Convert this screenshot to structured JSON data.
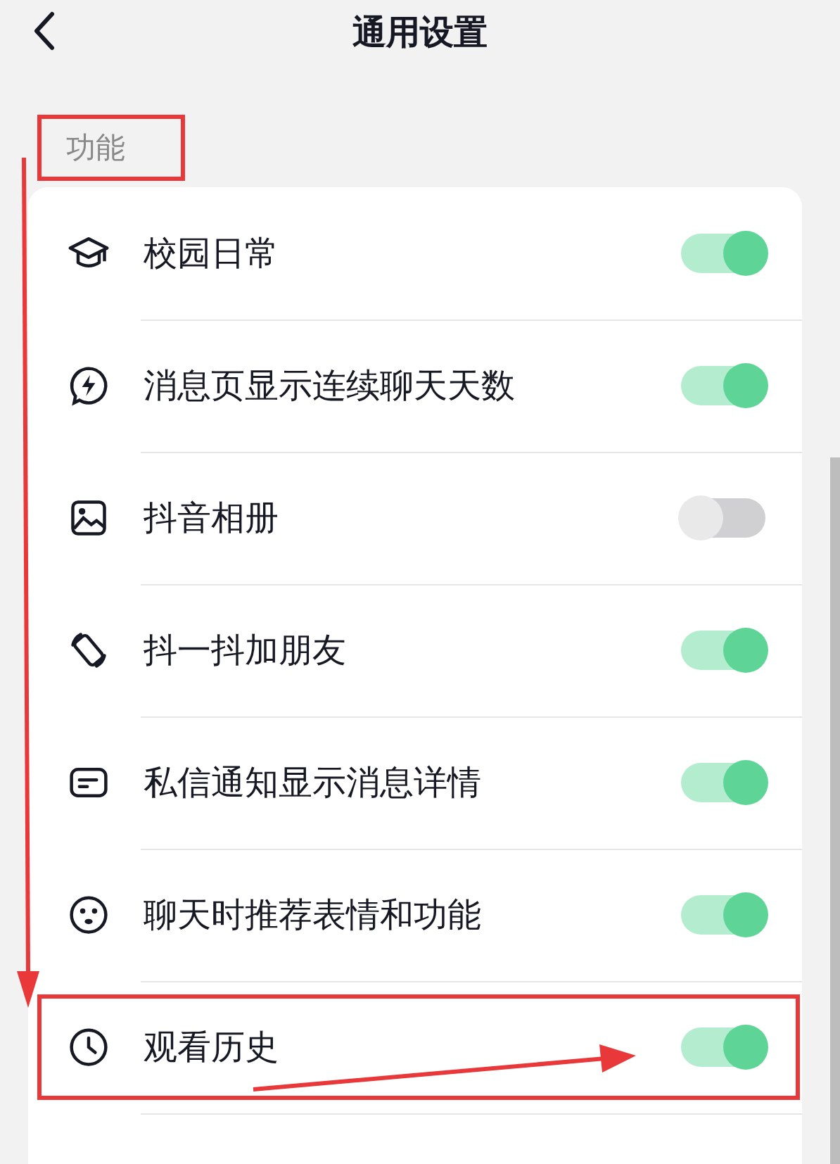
{
  "header": {
    "title": "通用设置"
  },
  "section": {
    "title": "功能"
  },
  "items": [
    {
      "kind": "cap",
      "label": "校园日常",
      "on": true
    },
    {
      "kind": "bolt",
      "label": "消息页显示连续聊天天数",
      "on": true
    },
    {
      "kind": "image",
      "label": "抖音相册",
      "on": false
    },
    {
      "kind": "shake",
      "label": "抖一抖加朋友",
      "on": true
    },
    {
      "kind": "card",
      "label": "私信通知显示消息详情",
      "on": true
    },
    {
      "kind": "smile",
      "label": "聊天时推荐表情和功能",
      "on": true
    },
    {
      "kind": "clock",
      "label": "观看历史",
      "on": true
    }
  ]
}
